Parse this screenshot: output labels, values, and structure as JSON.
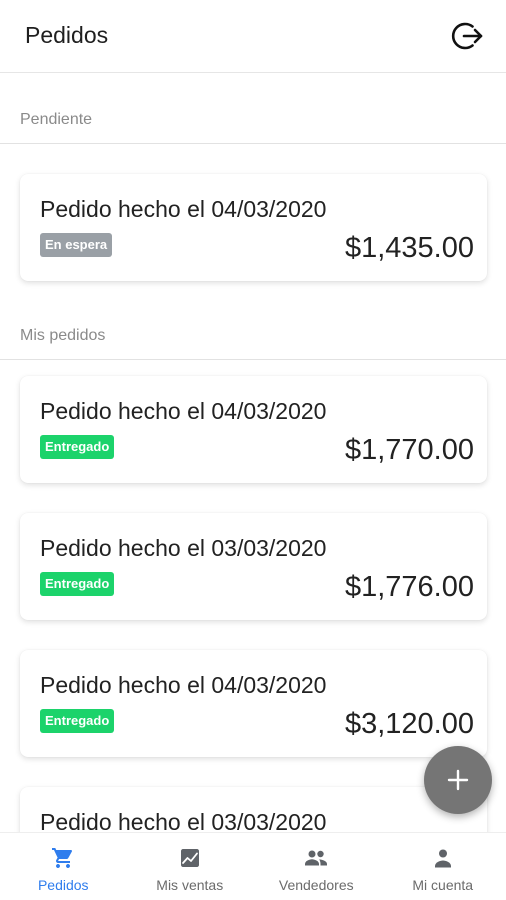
{
  "header": {
    "title": "Pedidos",
    "logout_icon": "logout-icon"
  },
  "sections": [
    {
      "label": "Pendiente"
    },
    {
      "label": "Mis pedidos"
    }
  ],
  "pending_orders": [
    {
      "title": "Pedido hecho el 04/03/2020",
      "status": "En espera",
      "status_color": "#9aa0a6",
      "amount": "$1,435.00"
    }
  ],
  "my_orders": [
    {
      "title": "Pedido hecho el 04/03/2020",
      "status": "Entregado",
      "status_color": "#1cd36b",
      "amount": "$1,770.00"
    },
    {
      "title": "Pedido hecho el 03/03/2020",
      "status": "Entregado",
      "status_color": "#1cd36b",
      "amount": "$1,776.00"
    },
    {
      "title": "Pedido hecho el 04/03/2020",
      "status": "Entregado",
      "status_color": "#1cd36b",
      "amount": "$3,120.00"
    },
    {
      "title": "Pedido hecho el 03/03/2020"
    }
  ],
  "fab": {
    "icon": "plus-icon"
  },
  "bottom_nav": {
    "active_color": "#2f7ded",
    "items": [
      {
        "label": "Pedidos",
        "icon": "cart-icon",
        "active": true
      },
      {
        "label": "Mis ventas",
        "icon": "chart-icon",
        "active": false
      },
      {
        "label": "Vendedores",
        "icon": "people-icon",
        "active": false
      },
      {
        "label": "Mi cuenta",
        "icon": "person-icon",
        "active": false
      }
    ]
  }
}
